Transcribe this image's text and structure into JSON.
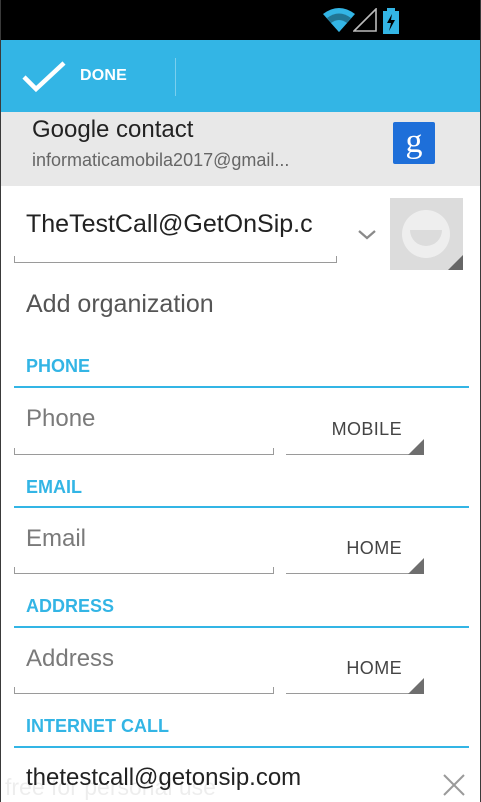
{
  "colors": {
    "accent": "#33b5e5",
    "status_bar": "#000000",
    "header_bg": "#e8e8e8",
    "google_blue": "#1e6fd9"
  },
  "action_bar": {
    "done_label": "DONE",
    "done_icon": "checkmark-icon"
  },
  "account": {
    "type": "Google contact",
    "email": "informaticamobila2017@gmail...",
    "logo_letter": "g"
  },
  "contact": {
    "name_value": "TheTestCall@GetOnSip.c",
    "add_organization": "Add organization"
  },
  "sections": {
    "phone": {
      "header": "PHONE",
      "placeholder": "Phone",
      "type": "MOBILE"
    },
    "email": {
      "header": "EMAIL",
      "placeholder": "Email",
      "type": "HOME"
    },
    "address": {
      "header": "ADDRESS",
      "placeholder": "Address",
      "type": "HOME"
    },
    "internet_call": {
      "header": "INTERNET CALL",
      "value": "thetestcall@getonsip.com"
    }
  },
  "watermark": "free for personal use"
}
